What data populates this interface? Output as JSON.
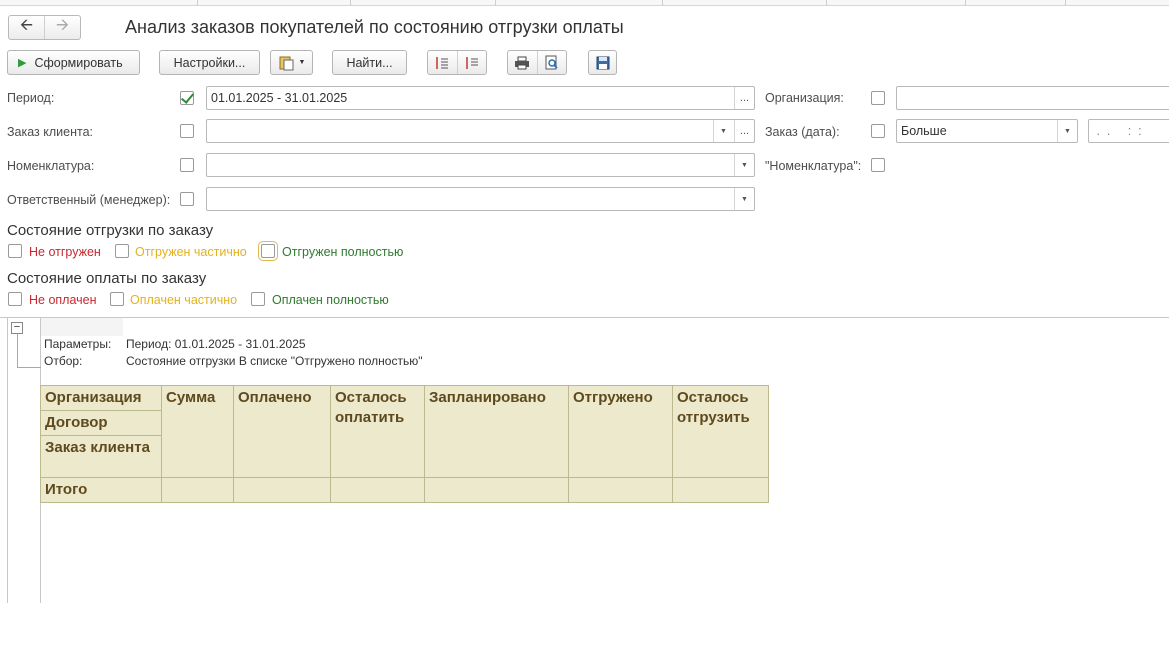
{
  "window": {
    "title": "Анализ заказов покупателей по состоянию отгрузки оплаты"
  },
  "nav": {
    "back_icon": "arrow-left-icon",
    "forward_icon": "arrow-right-icon"
  },
  "toolbar": {
    "generate_label": "Сформировать",
    "settings_label": "Настройки...",
    "find_label": "Найти..."
  },
  "filters": {
    "period": {
      "label": "Период:",
      "checked": true,
      "value": "01.01.2025 - 31.01.2025"
    },
    "client_order": {
      "label": "Заказ клиента:",
      "checked": false,
      "value": ""
    },
    "nomenclature": {
      "label": "Номенклатура:",
      "checked": false,
      "value": ""
    },
    "manager": {
      "label": "Ответственный (менеджер):",
      "checked": false,
      "value": ""
    },
    "organization": {
      "label": "Организация:",
      "checked": false,
      "value": ""
    },
    "order_date": {
      "label": "Заказ (дата):",
      "checked": false,
      "comparison": "Больше",
      "date_value": " .  .     :  :"
    },
    "nomenclature_quoted": {
      "label": "\"Номенклатура\":",
      "checked": false
    }
  },
  "shipment": {
    "title": "Состояние отгрузки по заказу",
    "options": [
      "Не отгружен",
      "Отгружен частично",
      "Отгружен полностью"
    ]
  },
  "payment": {
    "title": "Состояние оплаты по заказу",
    "options": [
      "Не оплачен",
      "Оплачен частично",
      "Оплачен полностью"
    ]
  },
  "report": {
    "params_label": "Параметры:",
    "params_value": "Период: 01.01.2025 - 31.01.2025",
    "filter_label": "Отбор:",
    "filter_value": "Состояние отгрузки В списке \"Отгружено полностью\"",
    "row_headers": [
      "Организация",
      "Договор",
      "Заказ клиента"
    ],
    "columns": [
      "Сумма",
      "Оплачено",
      "Осталось оплатить",
      "Запланировано",
      "Отгружено",
      "Осталось отгрузить"
    ],
    "total_label": "Итого"
  }
}
